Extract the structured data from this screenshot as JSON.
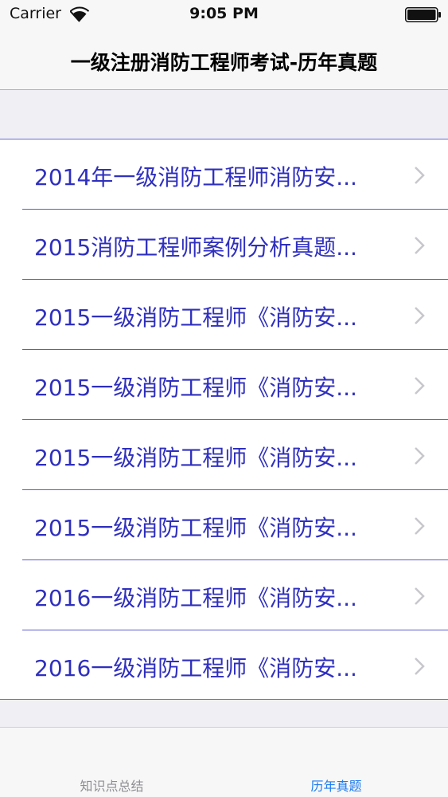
{
  "status_bar": {
    "carrier": "Carrier",
    "time": "9:05 PM",
    "icons": [
      "wifi-icon",
      "battery-icon"
    ]
  },
  "nav": {
    "title": "一级注册消防工程师考试-历年真题"
  },
  "list": {
    "items": [
      {
        "label": "2014年一级消防工程师消防安..."
      },
      {
        "label": "2015消防工程师案例分析真题..."
      },
      {
        "label": "2015一级消防工程师《消防安..."
      },
      {
        "label": "2015一级消防工程师《消防安..."
      },
      {
        "label": "2015一级消防工程师《消防安..."
      },
      {
        "label": "2015一级消防工程师《消防安..."
      },
      {
        "label": "2016一级消防工程师《消防安..."
      },
      {
        "label": "2016一级消防工程师《消防安..."
      }
    ],
    "item_icon": "chevron-right-icon"
  },
  "tab_bar": {
    "tabs": [
      {
        "label": "知识点总结",
        "selected": false
      },
      {
        "label": "历年真题",
        "selected": true
      }
    ]
  },
  "colors": {
    "item_text": "#2f2fbf",
    "separator": "#5b5bd0",
    "tab_selected": "#1e7cf0",
    "tab_unselected": "#8e8e93",
    "background": "#efeff4"
  }
}
